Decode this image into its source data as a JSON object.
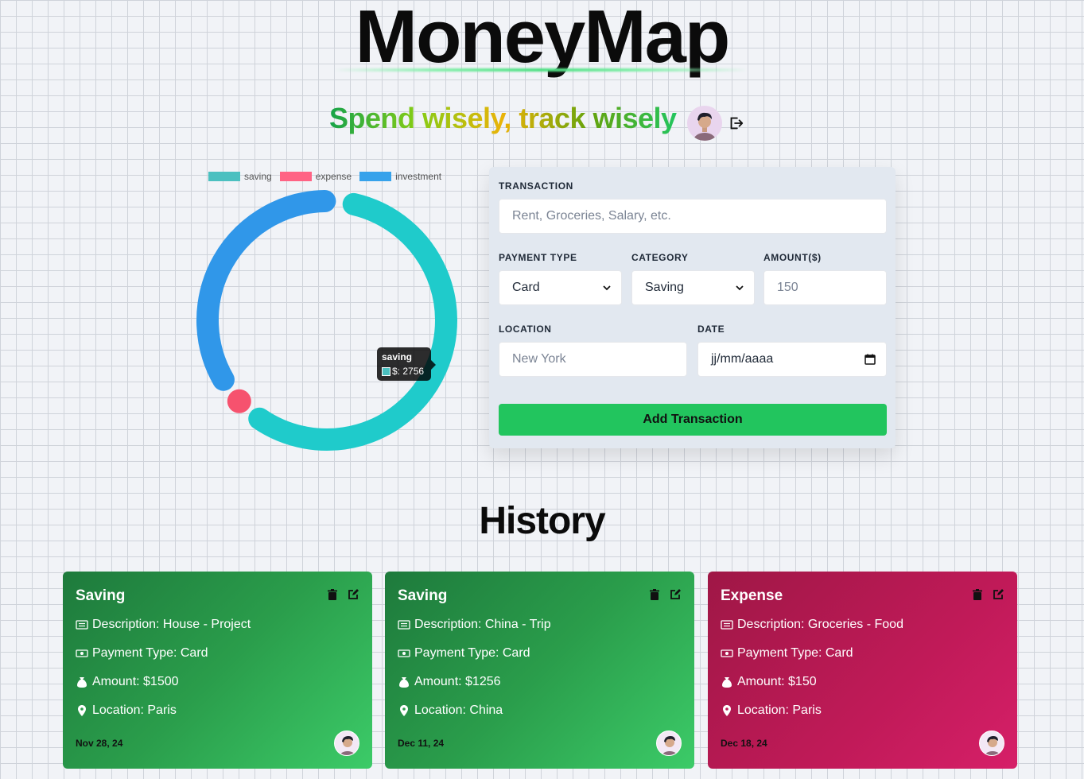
{
  "header": {
    "title": "MoneyMap",
    "tagline": "Spend wisely, track wisely"
  },
  "chart_data": {
    "type": "doughnut",
    "legend": [
      "saving",
      "expense",
      "investment"
    ],
    "series": [
      {
        "name": "saving",
        "value": 2756,
        "color": "#1fcbcb"
      },
      {
        "name": "expense",
        "value": 150,
        "color": "#f6526e"
      },
      {
        "name": "investment",
        "value": 1700,
        "color": "#3097e9"
      }
    ],
    "legend_placement": "top",
    "tooltip": {
      "title": "saving",
      "text": "$: 2756"
    }
  },
  "form": {
    "transaction_label": "TRANSACTION",
    "transaction_placeholder": "Rent, Groceries, Salary, etc.",
    "payment_type_label": "PAYMENT TYPE",
    "payment_type_value": "Card",
    "category_label": "CATEGORY",
    "category_value": "Saving",
    "amount_label": "AMOUNT($)",
    "amount_placeholder": "150",
    "location_label": "LOCATION",
    "location_placeholder": "New York",
    "date_label": "DATE",
    "date_placeholder": "jj/mm/aaaa",
    "submit_label": "Add Transaction"
  },
  "history": {
    "title": "History",
    "cards": [
      {
        "type": "Saving",
        "description": "Description: House - Project",
        "payment": "Payment Type: Card",
        "amount": "Amount: $1500",
        "location": "Location: Paris",
        "date": "Nov 28, 24"
      },
      {
        "type": "Saving",
        "description": "Description: China - Trip",
        "payment": "Payment Type: Card",
        "amount": "Amount: $1256",
        "location": "Location: China",
        "date": "Dec 11, 24"
      },
      {
        "type": "Expense",
        "description": "Description: Groceries - Food",
        "payment": "Payment Type: Card",
        "amount": "Amount: $150",
        "location": "Location: Paris",
        "date": "Dec 18, 24"
      }
    ]
  },
  "colors": {
    "accent": "#22c55e",
    "saving_card": "#2a9d4b",
    "expense_card": "#c01a58"
  }
}
